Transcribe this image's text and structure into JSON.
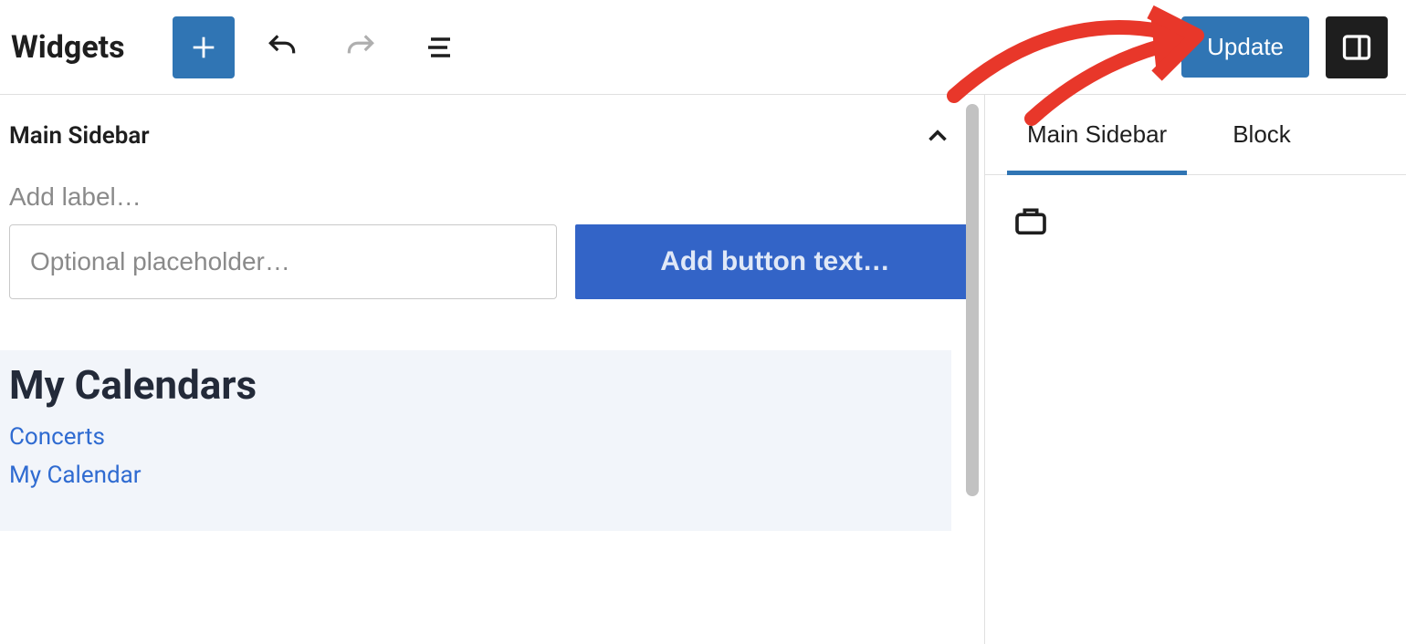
{
  "header": {
    "title": "Widgets",
    "update_label": "Update"
  },
  "editor": {
    "area_title": "Main Sidebar",
    "label_placeholder": "Add label…",
    "search_placeholder": "Optional placeholder…",
    "button_text_placeholder": "Add button text…",
    "calendars_block": {
      "heading": "My Calendars",
      "links": [
        "Concerts",
        "My Calendar"
      ]
    }
  },
  "sidebar": {
    "tabs": [
      {
        "label": "Main Sidebar",
        "active": true
      },
      {
        "label": "Block",
        "active": false
      }
    ]
  }
}
